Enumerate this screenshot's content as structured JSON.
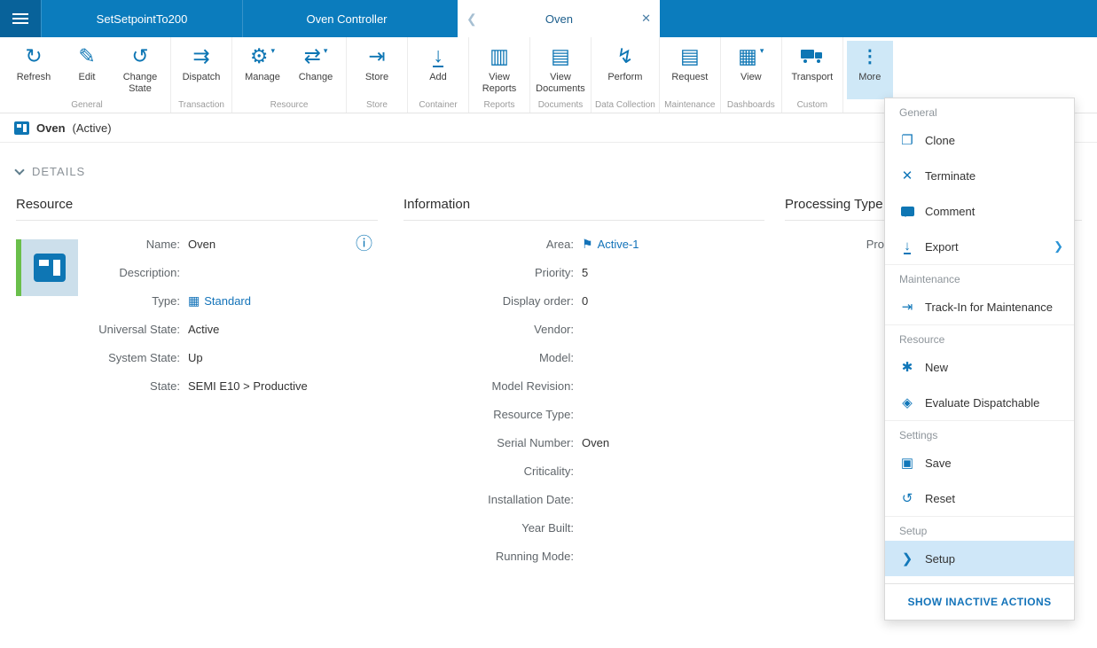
{
  "colors": {
    "accent": "#0b7cbd",
    "highlight": "#cfe8f7",
    "green": "#6abf4b",
    "link": "#1373b9"
  },
  "header": {
    "back_glyph": "❮",
    "close_glyph": "✕",
    "tabs": [
      {
        "label": "SetSetpointTo200",
        "active": false
      },
      {
        "label": "Oven Controller",
        "active": false
      },
      {
        "label": "Oven",
        "active": true
      }
    ]
  },
  "ribbon": {
    "groups": [
      {
        "label": "General",
        "buttons": [
          {
            "label": "Refresh",
            "glyph": "↻"
          },
          {
            "label": "Edit",
            "glyph": "✎"
          },
          {
            "label": "Change State",
            "glyph": "↺"
          }
        ]
      },
      {
        "label": "Transaction",
        "buttons": [
          {
            "label": "Dispatch",
            "glyph": "⇉"
          }
        ]
      },
      {
        "label": "Resource",
        "buttons": [
          {
            "label": "Manage",
            "glyph": "⚙",
            "caret": "▾"
          },
          {
            "label": "Change",
            "glyph": "⇄",
            "caret": "▾"
          }
        ]
      },
      {
        "label": "Store",
        "buttons": [
          {
            "label": "Store",
            "glyph": "⇥"
          }
        ]
      },
      {
        "label": "Container",
        "buttons": [
          {
            "label": "Add",
            "glyph": "↓"
          }
        ]
      },
      {
        "label": "Reports",
        "buttons": [
          {
            "label": "View Reports",
            "glyph": "▥"
          }
        ]
      },
      {
        "label": "Documents",
        "buttons": [
          {
            "label": "View Documents",
            "glyph": "▤"
          }
        ]
      },
      {
        "label": "Data Collection",
        "buttons": [
          {
            "label": "Perform",
            "glyph": "↯"
          }
        ]
      },
      {
        "label": "Maintenance",
        "buttons": [
          {
            "label": "Request",
            "glyph": "▤"
          }
        ]
      },
      {
        "label": "Dashboards",
        "buttons": [
          {
            "label": "View",
            "glyph": "▦",
            "caret": "▾"
          }
        ]
      },
      {
        "label": "Custom",
        "buttons": [
          {
            "label": "Transport",
            "glyph": ""
          }
        ]
      }
    ],
    "more": {
      "label": "More",
      "glyph": "⋮"
    }
  },
  "entity": {
    "title": "Oven",
    "state": "(Active)"
  },
  "details": {
    "section_label": "DETAILS"
  },
  "resource": {
    "header": "Resource",
    "info_glyph": "ⓘ",
    "fields": [
      {
        "label": "Name:",
        "value": "Oven"
      },
      {
        "label": "Description:",
        "value": ""
      },
      {
        "label": "Type:",
        "value": "Standard",
        "glyph": "▦"
      },
      {
        "label": "Universal State:",
        "value": "Active"
      },
      {
        "label": "System State:",
        "value": "Up"
      },
      {
        "label": "State:",
        "value": "SEMI E10 > Productive"
      }
    ]
  },
  "information": {
    "header": "Information",
    "fields": [
      {
        "label": "Area:",
        "value": "Active-1",
        "glyph": "⚑"
      },
      {
        "label": "Priority:",
        "value": "5"
      },
      {
        "label": "Display order:",
        "value": "0"
      },
      {
        "label": "Vendor:",
        "value": ""
      },
      {
        "label": "Model:",
        "value": ""
      },
      {
        "label": "Model Revision:",
        "value": ""
      },
      {
        "label": "Resource Type:",
        "value": ""
      },
      {
        "label": "Serial Number:",
        "value": "Oven"
      },
      {
        "label": "Criticality:",
        "value": ""
      },
      {
        "label": "Installation Date:",
        "value": ""
      },
      {
        "label": "Year Built:",
        "value": ""
      },
      {
        "label": "Running Mode:",
        "value": ""
      }
    ]
  },
  "processing": {
    "header": "Processing Type",
    "fields": [
      {
        "label": "Pro",
        "value": ""
      }
    ]
  },
  "menu": {
    "sections": [
      {
        "label": "General",
        "items": [
          {
            "label": "Clone",
            "glyph": "❐"
          },
          {
            "label": "Terminate",
            "glyph": "✕"
          },
          {
            "label": "Comment",
            "glyph": ""
          },
          {
            "label": "Export",
            "glyph": "↓",
            "submenu": "❯"
          }
        ]
      },
      {
        "label": "Maintenance",
        "items": [
          {
            "label": "Track-In for Maintenance",
            "glyph": "⇥"
          }
        ]
      },
      {
        "label": "Resource",
        "items": [
          {
            "label": "New",
            "glyph": "✱"
          },
          {
            "label": "Evaluate Dispatchable",
            "glyph": "◈"
          }
        ]
      },
      {
        "label": "Settings",
        "items": [
          {
            "label": "Save",
            "glyph": "▣"
          },
          {
            "label": "Reset",
            "glyph": "↺"
          }
        ]
      },
      {
        "label": "Setup",
        "items": [
          {
            "label": "Setup",
            "glyph": "❯",
            "highlighted": true
          }
        ]
      }
    ],
    "footer": "SHOW INACTIVE ACTIONS"
  }
}
